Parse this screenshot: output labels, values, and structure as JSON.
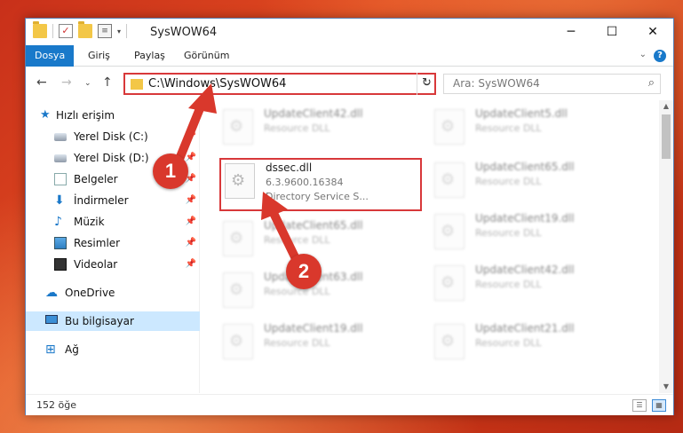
{
  "window": {
    "title": "SysWOW64",
    "min": "─",
    "max": "☐",
    "close": "✕"
  },
  "ribbon": {
    "tabs": [
      "Dosya",
      "Giriş",
      "Paylaş",
      "Görünüm"
    ],
    "help": "?"
  },
  "address": {
    "path": "C:\\Windows\\SysWOW64",
    "search_placeholder": "Ara: SysWOW64"
  },
  "sidebar": {
    "items": [
      {
        "label": "Hızlı erişim",
        "icon": "star-icon",
        "pinned": false
      },
      {
        "label": "Yerel Disk (C:)",
        "icon": "drive-icon",
        "pinned": true
      },
      {
        "label": "Yerel Disk (D:)",
        "icon": "drive-icon",
        "pinned": true
      },
      {
        "label": "Belgeler",
        "icon": "document-icon",
        "pinned": true
      },
      {
        "label": "İndirmeler",
        "icon": "download-icon",
        "pinned": true
      },
      {
        "label": "Müzik",
        "icon": "music-icon",
        "pinned": true
      },
      {
        "label": "Resimler",
        "icon": "pictures-icon",
        "pinned": true
      },
      {
        "label": "Videolar",
        "icon": "video-icon",
        "pinned": true
      },
      {
        "label": "OneDrive",
        "icon": "cloud-icon",
        "pinned": false
      },
      {
        "label": "Bu bilgisayar",
        "icon": "computer-icon",
        "pinned": false
      },
      {
        "label": "Ağ",
        "icon": "network-icon",
        "pinned": false
      }
    ]
  },
  "files": {
    "left": [
      {
        "name": "UpdateClient42.dll",
        "desc": "Resource DLL"
      },
      {
        "name": "dssec.dll",
        "desc": "6.3.9600.16384",
        "desc2": "Directory Service S..."
      },
      {
        "name": "UpdateClient65.dll",
        "desc": "Resource DLL"
      },
      {
        "name": "UpdateClient63.dll",
        "desc": "Resource DLL"
      },
      {
        "name": "UpdateClient19.dll",
        "desc": "Resource DLL"
      }
    ],
    "right": [
      {
        "name": "UpdateClient5.dll",
        "desc": "Resource DLL"
      },
      {
        "name": "UpdateClient65.dll",
        "desc": "Resource DLL"
      },
      {
        "name": "UpdateClient19.dll",
        "desc": "Resource DLL"
      },
      {
        "name": "UpdateClient42.dll",
        "desc": "Resource DLL"
      },
      {
        "name": "UpdateClient21.dll",
        "desc": "Resource DLL"
      }
    ]
  },
  "status": {
    "count": "152 öğe"
  },
  "annotations": {
    "step1": "1",
    "step2": "2"
  },
  "colors": {
    "accent": "#1979ca",
    "highlight": "#d8383a"
  }
}
